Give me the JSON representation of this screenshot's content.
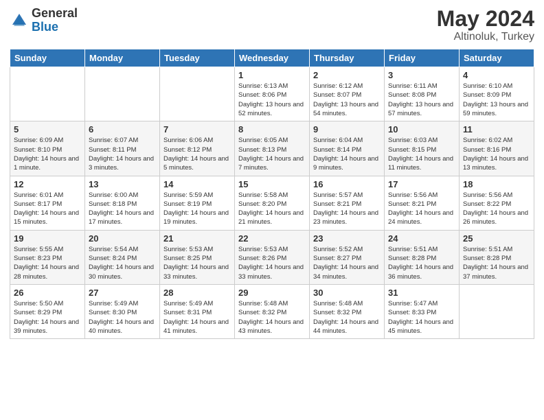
{
  "header": {
    "logo_general": "General",
    "logo_blue": "Blue",
    "month_year": "May 2024",
    "location": "Altinoluk, Turkey"
  },
  "days_of_week": [
    "Sunday",
    "Monday",
    "Tuesday",
    "Wednesday",
    "Thursday",
    "Friday",
    "Saturday"
  ],
  "weeks": [
    [
      {
        "day": "",
        "sunrise": "",
        "sunset": "",
        "daylight": ""
      },
      {
        "day": "",
        "sunrise": "",
        "sunset": "",
        "daylight": ""
      },
      {
        "day": "",
        "sunrise": "",
        "sunset": "",
        "daylight": ""
      },
      {
        "day": "1",
        "sunrise": "Sunrise: 6:13 AM",
        "sunset": "Sunset: 8:06 PM",
        "daylight": "Daylight: 13 hours and 52 minutes."
      },
      {
        "day": "2",
        "sunrise": "Sunrise: 6:12 AM",
        "sunset": "Sunset: 8:07 PM",
        "daylight": "Daylight: 13 hours and 54 minutes."
      },
      {
        "day": "3",
        "sunrise": "Sunrise: 6:11 AM",
        "sunset": "Sunset: 8:08 PM",
        "daylight": "Daylight: 13 hours and 57 minutes."
      },
      {
        "day": "4",
        "sunrise": "Sunrise: 6:10 AM",
        "sunset": "Sunset: 8:09 PM",
        "daylight": "Daylight: 13 hours and 59 minutes."
      }
    ],
    [
      {
        "day": "5",
        "sunrise": "Sunrise: 6:09 AM",
        "sunset": "Sunset: 8:10 PM",
        "daylight": "Daylight: 14 hours and 1 minute."
      },
      {
        "day": "6",
        "sunrise": "Sunrise: 6:07 AM",
        "sunset": "Sunset: 8:11 PM",
        "daylight": "Daylight: 14 hours and 3 minutes."
      },
      {
        "day": "7",
        "sunrise": "Sunrise: 6:06 AM",
        "sunset": "Sunset: 8:12 PM",
        "daylight": "Daylight: 14 hours and 5 minutes."
      },
      {
        "day": "8",
        "sunrise": "Sunrise: 6:05 AM",
        "sunset": "Sunset: 8:13 PM",
        "daylight": "Daylight: 14 hours and 7 minutes."
      },
      {
        "day": "9",
        "sunrise": "Sunrise: 6:04 AM",
        "sunset": "Sunset: 8:14 PM",
        "daylight": "Daylight: 14 hours and 9 minutes."
      },
      {
        "day": "10",
        "sunrise": "Sunrise: 6:03 AM",
        "sunset": "Sunset: 8:15 PM",
        "daylight": "Daylight: 14 hours and 11 minutes."
      },
      {
        "day": "11",
        "sunrise": "Sunrise: 6:02 AM",
        "sunset": "Sunset: 8:16 PM",
        "daylight": "Daylight: 14 hours and 13 minutes."
      }
    ],
    [
      {
        "day": "12",
        "sunrise": "Sunrise: 6:01 AM",
        "sunset": "Sunset: 8:17 PM",
        "daylight": "Daylight: 14 hours and 15 minutes."
      },
      {
        "day": "13",
        "sunrise": "Sunrise: 6:00 AM",
        "sunset": "Sunset: 8:18 PM",
        "daylight": "Daylight: 14 hours and 17 minutes."
      },
      {
        "day": "14",
        "sunrise": "Sunrise: 5:59 AM",
        "sunset": "Sunset: 8:19 PM",
        "daylight": "Daylight: 14 hours and 19 minutes."
      },
      {
        "day": "15",
        "sunrise": "Sunrise: 5:58 AM",
        "sunset": "Sunset: 8:20 PM",
        "daylight": "Daylight: 14 hours and 21 minutes."
      },
      {
        "day": "16",
        "sunrise": "Sunrise: 5:57 AM",
        "sunset": "Sunset: 8:21 PM",
        "daylight": "Daylight: 14 hours and 23 minutes."
      },
      {
        "day": "17",
        "sunrise": "Sunrise: 5:56 AM",
        "sunset": "Sunset: 8:21 PM",
        "daylight": "Daylight: 14 hours and 24 minutes."
      },
      {
        "day": "18",
        "sunrise": "Sunrise: 5:56 AM",
        "sunset": "Sunset: 8:22 PM",
        "daylight": "Daylight: 14 hours and 26 minutes."
      }
    ],
    [
      {
        "day": "19",
        "sunrise": "Sunrise: 5:55 AM",
        "sunset": "Sunset: 8:23 PM",
        "daylight": "Daylight: 14 hours and 28 minutes."
      },
      {
        "day": "20",
        "sunrise": "Sunrise: 5:54 AM",
        "sunset": "Sunset: 8:24 PM",
        "daylight": "Daylight: 14 hours and 30 minutes."
      },
      {
        "day": "21",
        "sunrise": "Sunrise: 5:53 AM",
        "sunset": "Sunset: 8:25 PM",
        "daylight": "Daylight: 14 hours and 33 minutes."
      },
      {
        "day": "22",
        "sunrise": "Sunrise: 5:53 AM",
        "sunset": "Sunset: 8:26 PM",
        "daylight": "Daylight: 14 hours and 33 minutes."
      },
      {
        "day": "23",
        "sunrise": "Sunrise: 5:52 AM",
        "sunset": "Sunset: 8:27 PM",
        "daylight": "Daylight: 14 hours and 34 minutes."
      },
      {
        "day": "24",
        "sunrise": "Sunrise: 5:51 AM",
        "sunset": "Sunset: 8:28 PM",
        "daylight": "Daylight: 14 hours and 36 minutes."
      },
      {
        "day": "25",
        "sunrise": "Sunrise: 5:51 AM",
        "sunset": "Sunset: 8:28 PM",
        "daylight": "Daylight: 14 hours and 37 minutes."
      }
    ],
    [
      {
        "day": "26",
        "sunrise": "Sunrise: 5:50 AM",
        "sunset": "Sunset: 8:29 PM",
        "daylight": "Daylight: 14 hours and 39 minutes."
      },
      {
        "day": "27",
        "sunrise": "Sunrise: 5:49 AM",
        "sunset": "Sunset: 8:30 PM",
        "daylight": "Daylight: 14 hours and 40 minutes."
      },
      {
        "day": "28",
        "sunrise": "Sunrise: 5:49 AM",
        "sunset": "Sunset: 8:31 PM",
        "daylight": "Daylight: 14 hours and 41 minutes."
      },
      {
        "day": "29",
        "sunrise": "Sunrise: 5:48 AM",
        "sunset": "Sunset: 8:32 PM",
        "daylight": "Daylight: 14 hours and 43 minutes."
      },
      {
        "day": "30",
        "sunrise": "Sunrise: 5:48 AM",
        "sunset": "Sunset: 8:32 PM",
        "daylight": "Daylight: 14 hours and 44 minutes."
      },
      {
        "day": "31",
        "sunrise": "Sunrise: 5:47 AM",
        "sunset": "Sunset: 8:33 PM",
        "daylight": "Daylight: 14 hours and 45 minutes."
      },
      {
        "day": "",
        "sunrise": "",
        "sunset": "",
        "daylight": ""
      }
    ]
  ]
}
